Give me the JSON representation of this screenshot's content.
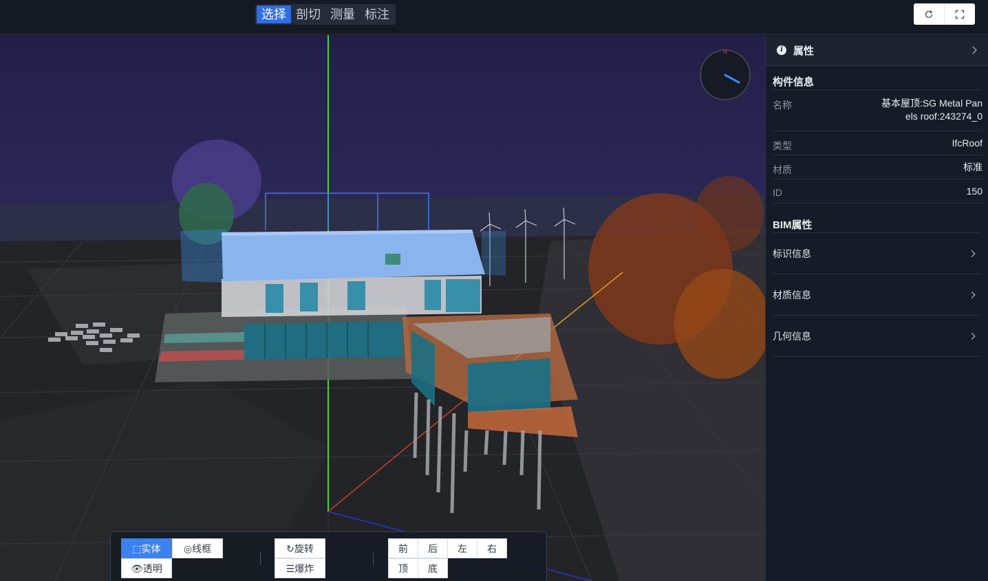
{
  "toolbar": {
    "modes": [
      {
        "label": "选择",
        "active": true
      },
      {
        "label": "剖切",
        "active": false
      },
      {
        "label": "测量",
        "active": false
      },
      {
        "label": "标注",
        "active": false
      }
    ],
    "refresh_icon": "refresh-icon",
    "fullscreen_icon": "fullscreen-icon"
  },
  "compass": {
    "north_label": "N"
  },
  "bottom_toolbar": {
    "solid": "实体",
    "wireframe": "线框",
    "transparent": "透明",
    "rotate": "旋转",
    "explode": "爆炸",
    "views": [
      "前",
      "后",
      "左",
      "右",
      "顶",
      "底"
    ]
  },
  "panel": {
    "title": "属性",
    "component_section": "构件信息",
    "fields": [
      {
        "key": "名称",
        "value_line1": "基本屋顶:SG Metal Pan",
        "value_line2": "els roof:243274_0"
      },
      {
        "key": "类型",
        "value": "IfcRoof"
      },
      {
        "key": "材质",
        "value": "标准"
      },
      {
        "key": "ID",
        "value": "150"
      }
    ],
    "bim_section": "BIM属性",
    "bim_items": [
      "标识信息",
      "材质信息",
      "几何信息"
    ]
  },
  "colors": {
    "accent": "#2f6fe4",
    "panel_bg": "#161c27",
    "y_axis": "#4ed32a",
    "x_axis": "#d04020",
    "z_axis": "#e0a020"
  }
}
